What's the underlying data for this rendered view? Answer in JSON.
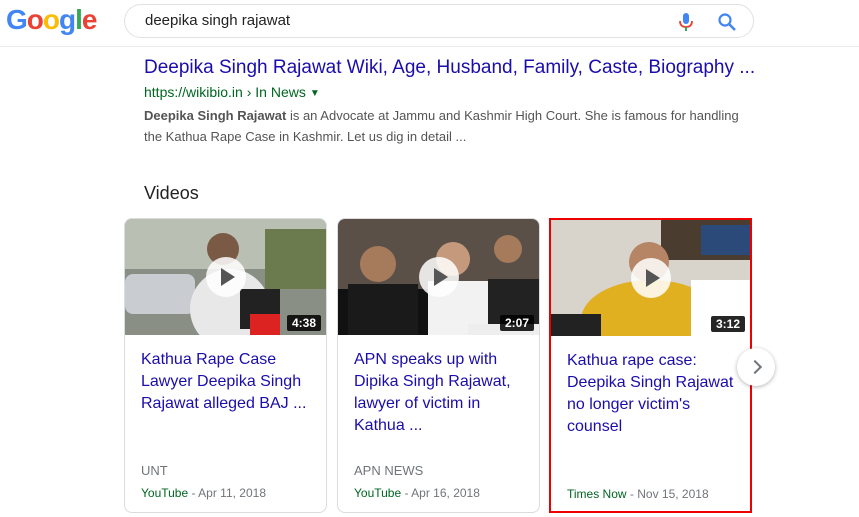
{
  "header": {
    "logo": [
      "G",
      "o",
      "o",
      "g",
      "l",
      "e"
    ],
    "logo_colors": [
      "#4285f4",
      "#ea4335",
      "#fbbc05",
      "#4285f4",
      "#34a853",
      "#ea4335"
    ],
    "search_query": "deepika singh rajawat",
    "mic_icon": "mic-icon",
    "search_icon": "search-icon"
  },
  "result": {
    "title": "Deepika Singh Rajawat Wiki, Age, Husband, Family, Caste, Biography ...",
    "url": "https://wikibio.in › In News",
    "snippet_bold": "Deepika Singh Rajawat",
    "snippet_rest": " is an Advocate at Jammu and Kashmir High Court. She is famous for handling the Kathua Rape Case in Kashmir. Let us dig in detail ..."
  },
  "videos": {
    "heading": "Videos",
    "items": [
      {
        "title": "Kathua Rape Case Lawyer Deepika Singh Rajawat alleged BAJ ...",
        "duration": "4:38",
        "source": "UNT",
        "publisher": "YouTube",
        "date": "Apr 11, 2018"
      },
      {
        "title": "APN speaks up with Dipika Singh Rajawat, lawyer of victim in Kathua ...",
        "duration": "2:07",
        "source": "APN NEWS",
        "publisher": "YouTube",
        "date": "Apr 16, 2018"
      },
      {
        "title": "Kathua rape case: Deepika Singh Rajawat no longer victim's counsel",
        "duration": "3:12",
        "source": "",
        "publisher": "Times Now",
        "date": "Nov 15, 2018"
      }
    ],
    "next_icon": "chevron-right-icon"
  }
}
